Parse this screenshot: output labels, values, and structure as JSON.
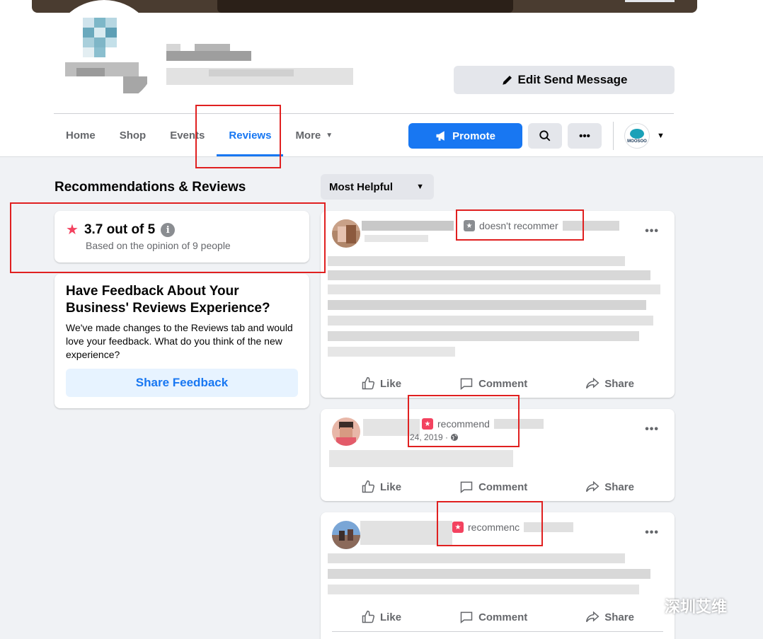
{
  "header": {
    "edit_button_label": "Edit Send Message"
  },
  "tabs": [
    {
      "label": "Home"
    },
    {
      "label": "Shop"
    },
    {
      "label": "Events"
    },
    {
      "label": "Reviews"
    },
    {
      "label": "More"
    }
  ],
  "actions_bar": {
    "promote_label": "Promote",
    "search_icon": "search-icon",
    "more_icon": "ellipsis-icon",
    "account_logo_text": "MOOSOO"
  },
  "section": {
    "title": "Recommendations & Reviews"
  },
  "rating": {
    "value_text": "3.7 out of 5",
    "subtitle": "Based on the opinion of 9 people",
    "star_color": "#f3425f"
  },
  "feedback": {
    "title": "Have Feedback About Your Business' Reviews Experience?",
    "text": "We've made changes to the Reviews tab and would love your feedback. What do you think of the new experience?",
    "button_label": "Share Feedback"
  },
  "sort": {
    "selected": "Most Helpful"
  },
  "reviews": [
    {
      "recommend_text": "doesn't recommer",
      "date": "",
      "like": "Like",
      "comment": "Comment",
      "share": "Share"
    },
    {
      "recommend_text": "recommend",
      "date": "24, 2019 ·",
      "like": "Like",
      "comment": "Comment",
      "share": "Share"
    },
    {
      "recommend_text": "recommenc",
      "date": "",
      "like": "Like",
      "comment": "Comment",
      "share": "Share"
    }
  ],
  "watermark": {
    "text": "深圳艾维"
  },
  "colors": {
    "accent": "#1877f2",
    "annotation": "#e02020"
  }
}
